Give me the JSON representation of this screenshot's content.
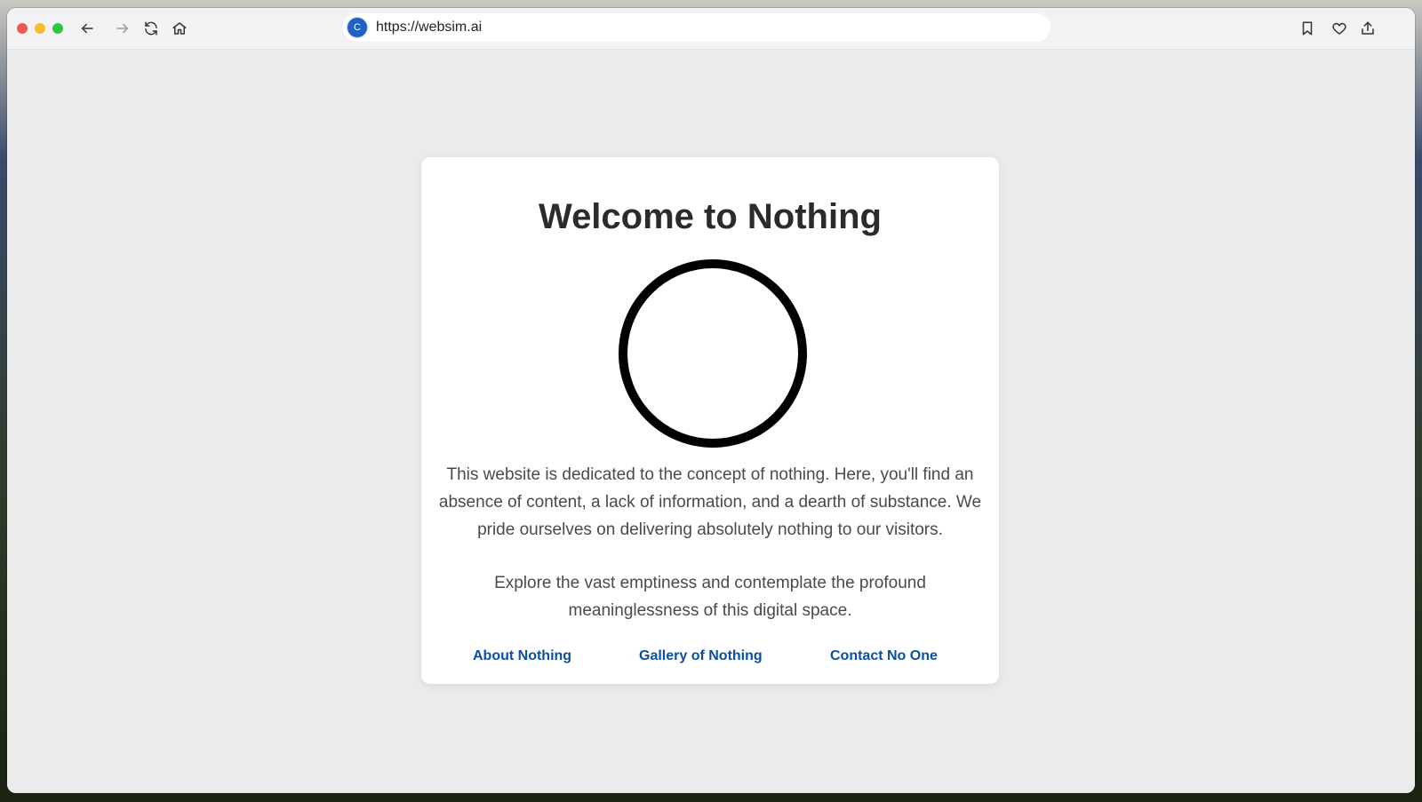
{
  "browser": {
    "url": "https://websim.ai",
    "favicon_letter": "C",
    "icons": {
      "back": "arrow-left-icon",
      "forward": "arrow-right-icon",
      "reload": "reload-icon",
      "home": "home-icon",
      "bookmark": "bookmark-icon",
      "favorite": "heart-icon",
      "share": "share-icon"
    }
  },
  "page": {
    "title": "Welcome to Nothing",
    "paragraph1": "This website is dedicated to the concept of nothing. Here, you'll find an absence of content, a lack of information, and a dearth of substance. We pride ourselves on delivering absolutely nothing to our visitors.",
    "paragraph2": "Explore the vast emptiness and contemplate the profound meaninglessness of this digital space.",
    "links": [
      "About Nothing",
      "Gallery of Nothing",
      "Contact No One"
    ]
  },
  "colors": {
    "link": "#0b4fa3",
    "title": "#2b2b2b",
    "text": "#4a4a4a",
    "background": "#ebebeb"
  }
}
